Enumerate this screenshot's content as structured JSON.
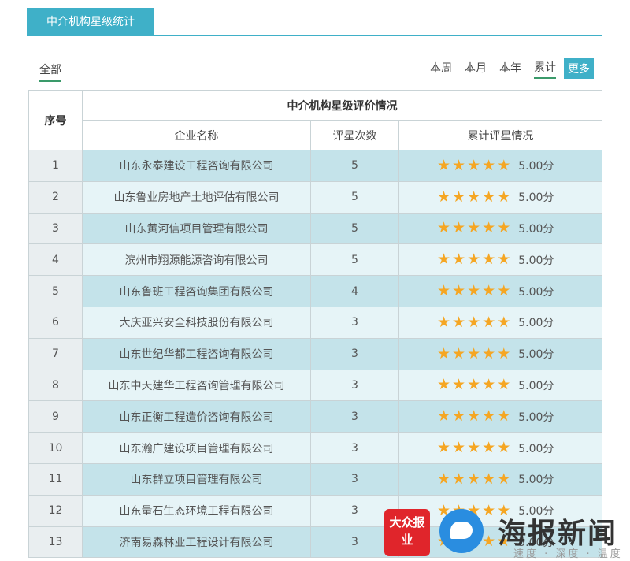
{
  "header": {
    "tab_label": "中介机构星级统计"
  },
  "filter": {
    "all_label": "全部"
  },
  "periods": {
    "items": [
      "本周",
      "本月",
      "本年",
      "累计"
    ],
    "active": "累计",
    "more_label": "更多"
  },
  "table": {
    "seq_header": "序号",
    "group_header": "中介机构星级评价情况",
    "columns": [
      "企业名称",
      "评星次数",
      "累计评星情况"
    ],
    "rows": [
      {
        "seq": "1",
        "name": "山东永泰建设工程咨询有限公司",
        "count": "5",
        "stars": 5,
        "score": "5.00分"
      },
      {
        "seq": "2",
        "name": "山东鲁业房地产土地评估有限公司",
        "count": "5",
        "stars": 5,
        "score": "5.00分"
      },
      {
        "seq": "3",
        "name": "山东黄河信项目管理有限公司",
        "count": "5",
        "stars": 5,
        "score": "5.00分"
      },
      {
        "seq": "4",
        "name": "滨州市翔源能源咨询有限公司",
        "count": "5",
        "stars": 5,
        "score": "5.00分"
      },
      {
        "seq": "5",
        "name": "山东鲁班工程咨询集团有限公司",
        "count": "4",
        "stars": 5,
        "score": "5.00分"
      },
      {
        "seq": "6",
        "name": "大庆亚兴安全科技股份有限公司",
        "count": "3",
        "stars": 5,
        "score": "5.00分"
      },
      {
        "seq": "7",
        "name": "山东世纪华都工程咨询有限公司",
        "count": "3",
        "stars": 5,
        "score": "5.00分"
      },
      {
        "seq": "8",
        "name": "山东中天建华工程咨询管理有限公司",
        "count": "3",
        "stars": 5,
        "score": "5.00分"
      },
      {
        "seq": "9",
        "name": "山东正衡工程造价咨询有限公司",
        "count": "3",
        "stars": 5,
        "score": "5.00分"
      },
      {
        "seq": "10",
        "name": "山东瀚广建设项目管理有限公司",
        "count": "3",
        "stars": 5,
        "score": "5.00分"
      },
      {
        "seq": "11",
        "name": "山东群立项目管理有限公司",
        "count": "3",
        "stars": 5,
        "score": "5.00分"
      },
      {
        "seq": "12",
        "name": "山东量石生态环境工程有限公司",
        "count": "3",
        "stars": 5,
        "score": "5.00分"
      },
      {
        "seq": "13",
        "name": "济南易森林业工程设计有限公司",
        "count": "3",
        "stars": 5,
        "score": "5.00分"
      }
    ]
  },
  "watermark": {
    "badge_text": "大众报业",
    "brand_text": "海报新闻",
    "slogan": "速度 · 深度 · 温度"
  },
  "colors": {
    "accent": "#3fb0c8",
    "star": "#f5a623",
    "row_odd": "#c4e3ea",
    "row_even": "#e6f4f7"
  }
}
